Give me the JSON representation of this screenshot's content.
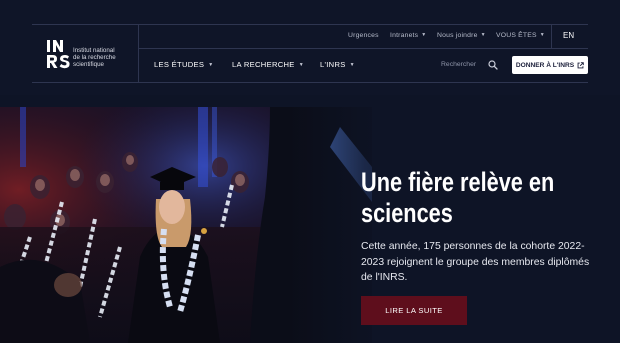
{
  "brand": {
    "logo_letters_top": "INRS",
    "logo_lines": [
      "Institut national",
      "de la recherche",
      "scientifique"
    ]
  },
  "utility_nav": [
    {
      "label": "Urgences",
      "has_menu": false
    },
    {
      "label": "Intranets",
      "has_menu": true
    },
    {
      "label": "Nous joindre",
      "has_menu": true
    },
    {
      "label": "VOUS ÊTES",
      "has_menu": true
    }
  ],
  "language_toggle": "EN",
  "main_nav": [
    {
      "label": "LES ÉTUDES",
      "has_menu": true
    },
    {
      "label": "LA RECHERCHE",
      "has_menu": true
    },
    {
      "label": "L'INRS",
      "has_menu": true
    }
  ],
  "search": {
    "label": "Rechercher",
    "icon": "search-icon"
  },
  "donate_button": {
    "label": "DONNER À L'INRS",
    "icon": "external-link-icon"
  },
  "hero": {
    "title_line1": "Une fière relève en",
    "title_line2": "sciences",
    "body": "Cette année, 175 personnes de la cohorte 2022-2023 rejoignent le groupe des membres diplômés de l'INRS.",
    "cta_label": "LIRE LA SUITE"
  },
  "colors": {
    "background": "#0e1426",
    "header": "#0f1528",
    "cta": "#5e0e1c",
    "donate_bg": "#ffffff"
  }
}
